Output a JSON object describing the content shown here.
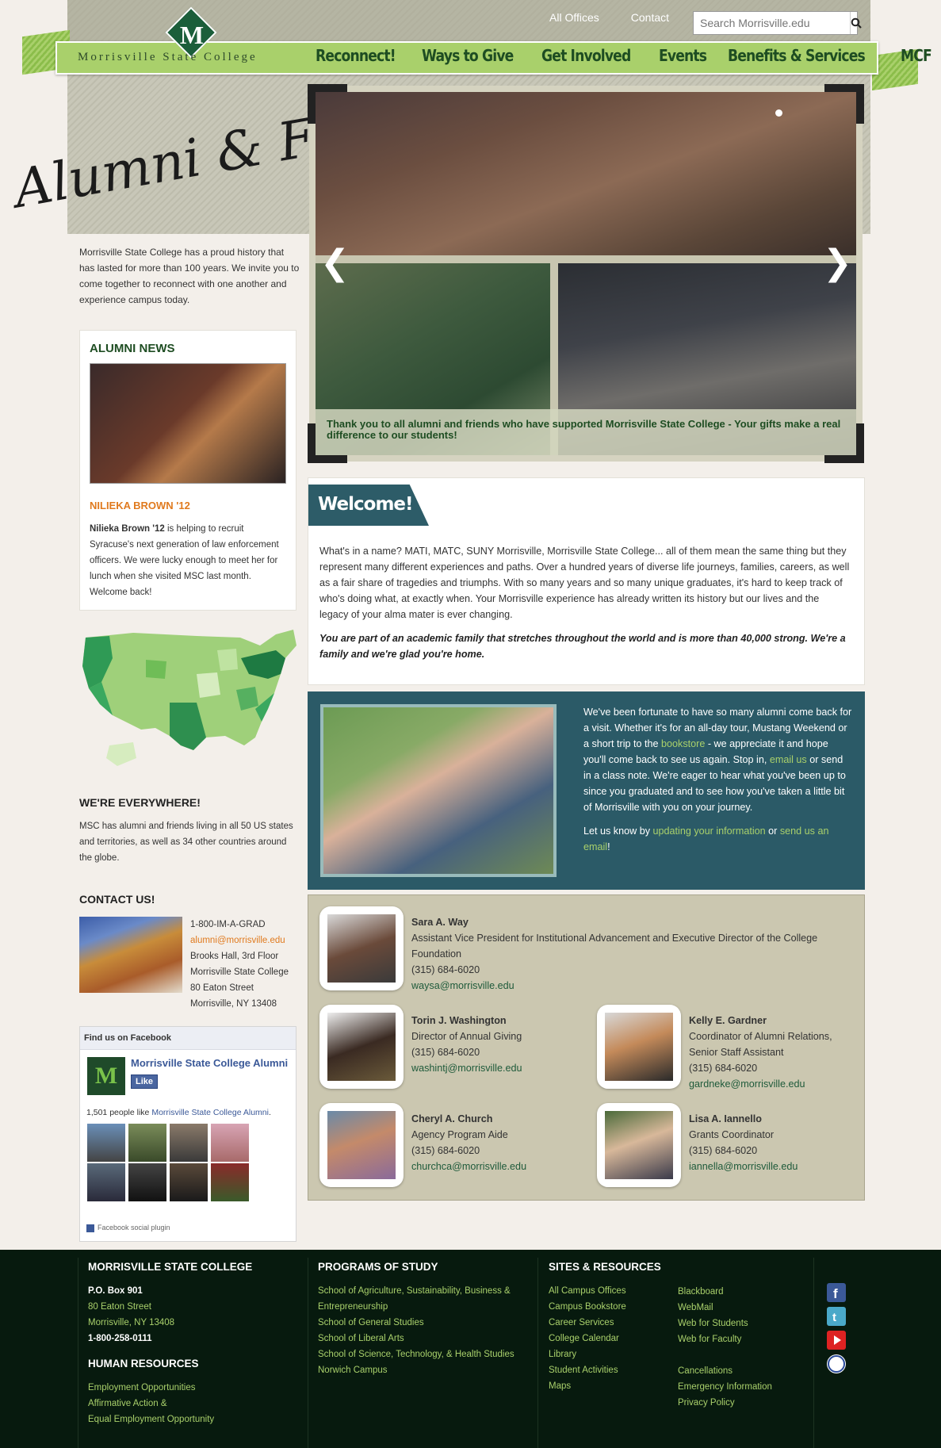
{
  "header": {
    "top_links": [
      "All Offices",
      "Contact"
    ],
    "search_placeholder": "Search Morrisville.edu",
    "brand": "Morrisville State College",
    "nav": [
      "Reconnect!",
      "Ways to Give",
      "Get Involved",
      "Events",
      "Benefits & Services",
      "MCF"
    ],
    "script_title": "Alumni & Friends"
  },
  "intro": "Morrisville State College has a proud history that has lasted for more than 100 years. We invite you to come together to reconnect with one another and experience campus today.",
  "slider": {
    "caption": "Thank you to all alumni and friends who have supported Morrisville State College - Your gifts make a real difference to our students!"
  },
  "news": {
    "heading": "ALUMNI NEWS",
    "title": "NILIEKA BROWN '12",
    "name_bold": "Nilieka Brown '12",
    "body": " is helping to recruit Syracuse's next generation of law enforcement officers. We were lucky enough to meet her for lunch when she visited MSC last month. Welcome back!"
  },
  "everywhere": {
    "heading": "WE'RE EVERYWHERE!",
    "body": "MSC has alumni and friends living in all 50 US states and territories, as well as 34 other countries around the globe."
  },
  "contact": {
    "heading": "CONTACT US!",
    "phone": "1-800-IM-A-GRAD",
    "email": "alumni@morrisville.edu",
    "line1": "Brooks Hall, 3rd Floor",
    "line2": "Morrisville State College",
    "line3": "80 Eaton Street",
    "line4": "Morrisville, NY 13408"
  },
  "facebook": {
    "header": "Find us on Facebook",
    "page_name": "Morrisville State College Alumni",
    "like": "Like",
    "count_prefix": "1,501 people like ",
    "count_link": "Morrisville State College Alumni",
    "count_suffix": ".",
    "plugin": "Facebook social plugin"
  },
  "welcome": {
    "tag": "Welcome!",
    "body": "What's in a name? MATI, MATC, SUNY Morrisville, Morrisville State College... all of them mean the same thing but they represent many different experiences and paths. Over a hundred years of diverse life journeys, families, careers, as well as a fair share of tragedies and triumphs. With so many years and so many unique graduates, it's hard to keep track of who's doing what, at exactly when. Your Morrisville experience has already written its history but our lives and the legacy of your alma mater is ever changing.",
    "strong": "You are part of an academic family that stretches throughout the world and is more than 40,000 strong. We're a family and we're glad you're home."
  },
  "visit": {
    "p1_a": "We've been fortunate to have so many alumni come back for a visit. Whether it's for an all-day tour, Mustang Weekend or a short trip to the ",
    "bookstore": "bookstore",
    "p1_b": " - we appreciate it and hope you'll come back to see us again. Stop in, ",
    "email_us": "email us",
    "p1_c": " or send in a class note. We're eager to hear what you've been up to since you graduated and to see how you've taken a little bit of Morrisville with you on your journey.",
    "p2_a": "Let us know by ",
    "update": "updating your information",
    "p2_b": " or ",
    "send": "send us an email",
    "p2_c": "!"
  },
  "staff": [
    {
      "name": "Sara A. Way",
      "title": "Assistant Vice President for Institutional Advancement and Executive Director of the College Foundation",
      "phone": "(315) 684-6020",
      "email": "waysa@morrisville.edu"
    },
    {
      "name": "Torin J. Washington",
      "title": "Director of Annual Giving",
      "phone": "(315) 684-6020",
      "email": "washintj@morrisville.edu"
    },
    {
      "name": "Kelly E. Gardner",
      "title": "Coordinator of Alumni Relations, Senior Staff Assistant",
      "phone": "(315) 684-6020",
      "email": "gardneke@morrisville.edu"
    },
    {
      "name": "Cheryl A. Church",
      "title": "Agency Program Aide",
      "phone": "(315) 684-6020",
      "email": "churchca@morrisville.edu"
    },
    {
      "name": "Lisa A. Iannello",
      "title": "Grants Coordinator",
      "phone": "(315) 684-6020",
      "email": "iannella@morrisville.edu"
    }
  ],
  "footer": {
    "college_heading": "MORRISVILLE STATE COLLEGE",
    "pobox": "P.O. Box 901",
    "street": "80 Eaton Street",
    "city": "Morrisville, NY 13408",
    "phone": "1-800-258-0111",
    "hr_heading": "HUMAN RESOURCES",
    "hr_links": [
      "Employment Opportunities",
      "Affirmative Action &",
      "Equal Employment Opportunity"
    ],
    "programs_heading": "PROGRAMS OF STUDY",
    "programs": [
      "School of Agriculture, Sustainability, Business &",
      "Entrepreneurship",
      "School of General Studies",
      "School of Liberal Arts",
      "School of Science, Technology, & Health Studies",
      "Norwich Campus"
    ],
    "sites_heading": "SITES & RESOURCES",
    "sites_col1": [
      "All Campus Offices",
      "Campus Bookstore",
      "Career Services",
      "College Calendar",
      "Library",
      "Student Activities",
      "Maps"
    ],
    "sites_col2": [
      "Blackboard",
      "WebMail",
      "Web for Students",
      "Web for Faculty",
      "",
      "Cancellations",
      "Emergency Information",
      "Privacy Policy"
    ],
    "social": [
      "facebook-icon",
      "twitter-icon",
      "youtube-icon",
      "suny-icon"
    ]
  },
  "colors": {
    "accent": "#a9d06b",
    "brand_green": "#1e4d22",
    "teal": "#2b5a67",
    "orange": "#e07a1e",
    "footer_bg": "#071a0e"
  }
}
